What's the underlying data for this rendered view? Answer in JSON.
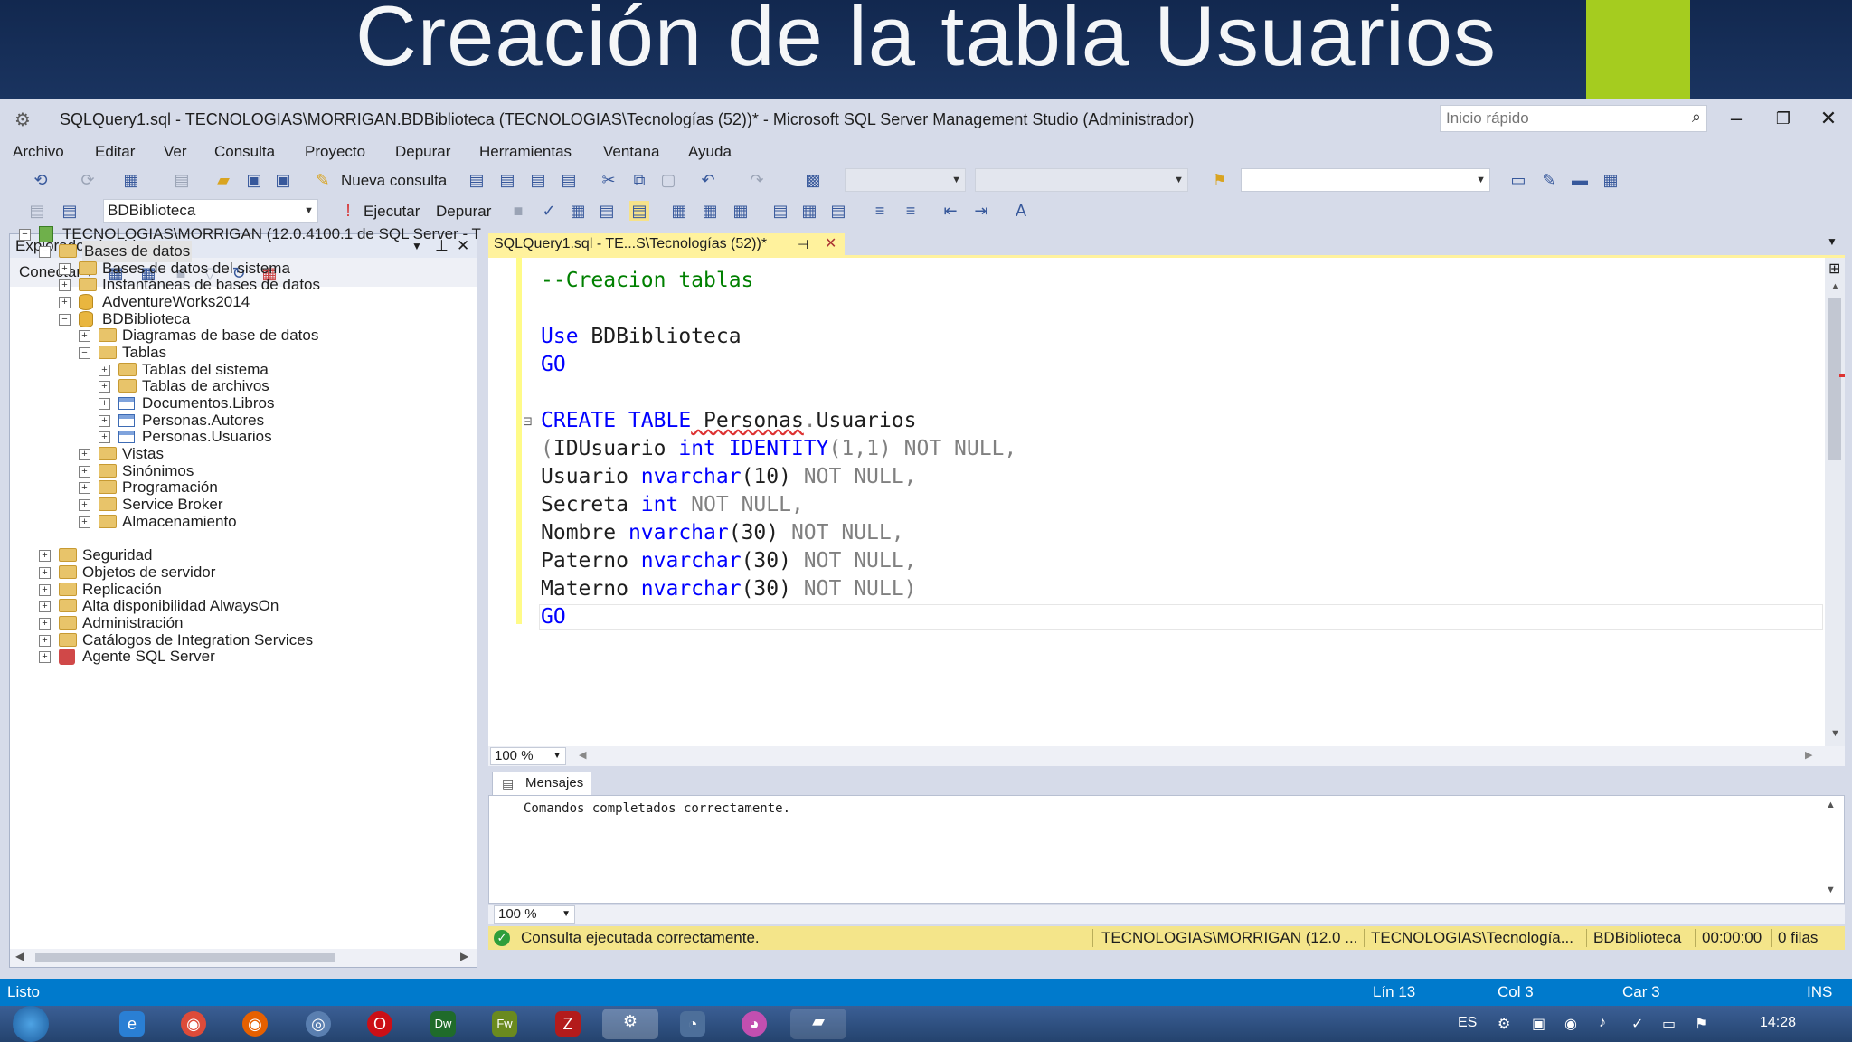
{
  "slide": {
    "title": "Creación de la tabla Usuarios"
  },
  "window": {
    "title": "SQLQuery1.sql - TECNOLOGIAS\\MORRIGAN.BDBiblioteca (TECNOLOGIAS\\Tecnologías (52))* - Microsoft SQL Server Management Studio (Administrador)",
    "quick_launch_placeholder": "Inicio rápido"
  },
  "menu": [
    "Archivo",
    "Editar",
    "Ver",
    "Consulta",
    "Proyecto",
    "Depurar",
    "Herramientas",
    "Ventana",
    "Ayuda"
  ],
  "toolbar1": {
    "new_query_label": "Nueva consulta"
  },
  "toolbar2": {
    "database_combo": "BDBiblioteca",
    "execute_label": "Ejecutar",
    "debug_label": "Depurar"
  },
  "object_explorer": {
    "title": "Explorador de objetos",
    "connect_label": "Conectar",
    "tree": [
      {
        "label": "TECNOLOGIAS\\MORRIGAN (12.0.4100.1 de SQL Server - T",
        "expander": "−",
        "icon": "server-icon"
      },
      {
        "label": "Bases de datos",
        "expander": "−",
        "icon": "folder-icon"
      },
      {
        "label": "Bases de datos del sistema",
        "expander": "+",
        "icon": "folder-icon"
      },
      {
        "label": "Instantáneas de bases de datos",
        "expander": "+",
        "icon": "folder-icon"
      },
      {
        "label": "AdventureWorks2014",
        "expander": "+",
        "icon": "database-icon"
      },
      {
        "label": "BDBiblioteca",
        "expander": "−",
        "icon": "database-icon"
      },
      {
        "label": "Diagramas de base de datos",
        "expander": "+",
        "icon": "folder-icon"
      },
      {
        "label": "Tablas",
        "expander": "−",
        "icon": "folder-icon"
      },
      {
        "label": "Tablas del sistema",
        "expander": "+",
        "icon": "folder-icon"
      },
      {
        "label": "Tablas de archivos",
        "expander": "+",
        "icon": "folder-icon"
      },
      {
        "label": "Documentos.Libros",
        "expander": "+",
        "icon": "table-icon"
      },
      {
        "label": "Personas.Autores",
        "expander": "+",
        "icon": "table-icon"
      },
      {
        "label": "Personas.Usuarios",
        "expander": "+",
        "icon": "table-icon"
      },
      {
        "label": "Vistas",
        "expander": "+",
        "icon": "folder-icon"
      },
      {
        "label": "Sinónimos",
        "expander": "+",
        "icon": "folder-icon"
      },
      {
        "label": "Programación",
        "expander": "+",
        "icon": "folder-icon"
      },
      {
        "label": "Service Broker",
        "expander": "+",
        "icon": "folder-icon"
      },
      {
        "label": "Almacenamiento",
        "expander": "+",
        "icon": "folder-icon"
      },
      {
        "label": "Seguridad",
        "expander": "+",
        "icon": "folder-icon"
      },
      {
        "label": "Seguridad",
        "expander": "+",
        "icon": "folder-icon"
      },
      {
        "label": "Objetos de servidor",
        "expander": "+",
        "icon": "folder-icon"
      },
      {
        "label": "Replicación",
        "expander": "+",
        "icon": "folder-icon"
      },
      {
        "label": "Alta disponibilidad AlwaysOn",
        "expander": "+",
        "icon": "folder-icon"
      },
      {
        "label": "Administración",
        "expander": "+",
        "icon": "folder-icon"
      },
      {
        "label": "Catálogos de Integration Services",
        "expander": "+",
        "icon": "folder-icon"
      },
      {
        "label": "Agente SQL Server",
        "expander": "+",
        "icon": "agent-icon"
      }
    ]
  },
  "editor": {
    "tab_title": "SQLQuery1.sql - TE...S\\Tecnologías (52))*",
    "zoom": "100 %",
    "code": {
      "l1_comment": "--Creacion tablas",
      "l3_kw": "Use",
      "l3_rest": " BDBiblioteca",
      "l4_kw": "GO",
      "l6_kw": "CREATE TABLE",
      "l6_obj": " Personas",
      "l6_dot": ".",
      "l6_tbl": "Usuarios",
      "l7_paren": "(",
      "l7_name": "IDUsuario ",
      "l7_type": "int",
      "l7_sp": " ",
      "l7_ident": "IDENTITY",
      "l7_args": "(1,1)",
      "l7_null": " NOT NULL,",
      "l8_name": "Usuario ",
      "l8_type": "nvarchar",
      "l8_args": "(10)",
      "l8_null": " NOT NULL,",
      "l9_name": "Secreta ",
      "l9_type": "int",
      "l9_null": " NOT NULL,",
      "l10_name": "Nombre ",
      "l10_type": "nvarchar",
      "l10_args": "(30)",
      "l10_null": " NOT NULL,",
      "l11_name": "Paterno ",
      "l11_type": "nvarchar",
      "l11_args": "(30)",
      "l11_null": " NOT NULL,",
      "l12_name": "Materno ",
      "l12_type": "nvarchar",
      "l12_args": "(30)",
      "l12_null": " NOT NULL)",
      "l13_kw": "GO"
    }
  },
  "results": {
    "tab_label": "Mensajes",
    "message": "Comandos completados correctamente.",
    "zoom": "100 %"
  },
  "query_status": {
    "message": "Consulta ejecutada correctamente.",
    "server": "TECNOLOGIAS\\MORRIGAN (12.0 ...",
    "user": "TECNOLOGIAS\\Tecnología...",
    "database": "BDBiblioteca",
    "elapsed": "00:00:00",
    "rows": "0 filas"
  },
  "app_status": {
    "ready": "Listo",
    "line": "Lín 13",
    "col": "Col 3",
    "char": "Car 3",
    "mode": "INS"
  },
  "taskbar": {
    "lang": "ES",
    "time": "14:28"
  },
  "colors": {
    "accent_blue": "#007acc",
    "tab_yellow": "#fff29d",
    "keyword": "#0000ff",
    "comment": "#008000"
  }
}
